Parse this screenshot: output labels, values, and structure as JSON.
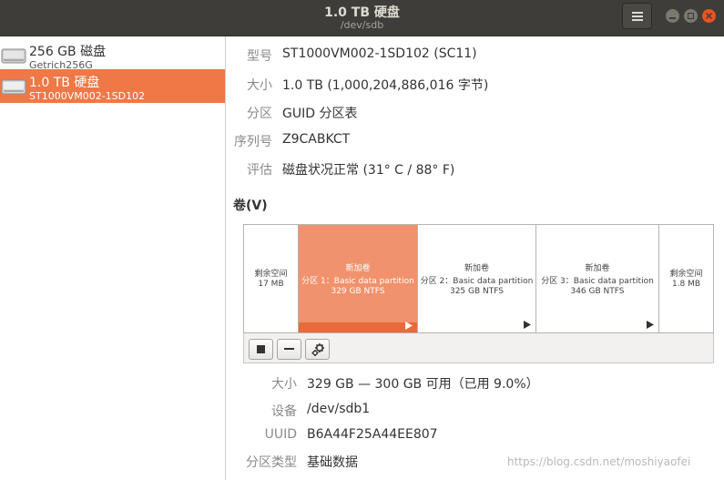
{
  "window": {
    "title": "1.0 TB 硬盘",
    "subtitle": "/dev/sdb"
  },
  "sidebar": {
    "drives": [
      {
        "name": "256 GB 磁盘",
        "model": "Getrich256G",
        "selected": false
      },
      {
        "name": "1.0 TB 硬盘",
        "model": "ST1000VM002-1SD102",
        "selected": true
      }
    ]
  },
  "drive_info": {
    "model_label": "型号",
    "model_value": "ST1000VM002-1SD102 (SC11)",
    "size_label": "大小",
    "size_value": "1.0 TB (1,000,204,886,016 字节)",
    "partitioning_label": "分区",
    "partitioning_value": "GUID 分区表",
    "serial_label": "序列号",
    "serial_value": "Z9CABKCT",
    "assessment_label": "评估",
    "assessment_value": "磁盘状况正常 (31° C / 88° F)"
  },
  "volumes": {
    "heading": "卷(V)",
    "segments": [
      {
        "line1": "剩余空间",
        "line2": "17 MB",
        "line3": ""
      },
      {
        "line1": "新加卷",
        "line2": "分区 1：Basic data partition",
        "line3": "329 GB NTFS",
        "selected": true
      },
      {
        "line1": "新加卷",
        "line2": "分区 2：Basic data partition",
        "line3": "325 GB NTFS"
      },
      {
        "line1": "新加卷",
        "line2": "分区 3：Basic data partition",
        "line3": "346 GB NTFS"
      },
      {
        "line1": "剩余空间",
        "line2": "1.8 MB",
        "line3": ""
      }
    ]
  },
  "partition_info": {
    "size_label": "大小",
    "size_value": "329 GB — 300 GB 可用（已用 9.0%）",
    "device_label": "设备",
    "device_value": "/dev/sdb1",
    "uuid_label": "UUID",
    "uuid_value": "B6A44F25A44EE807",
    "type_label": "分区类型",
    "type_value": "基础数据"
  },
  "watermark": "https://blog.csdn.net/moshiyaofei",
  "colors": {
    "accent": "#f07746",
    "titlebar": "#3e3d39",
    "close_button": "#e95420"
  }
}
